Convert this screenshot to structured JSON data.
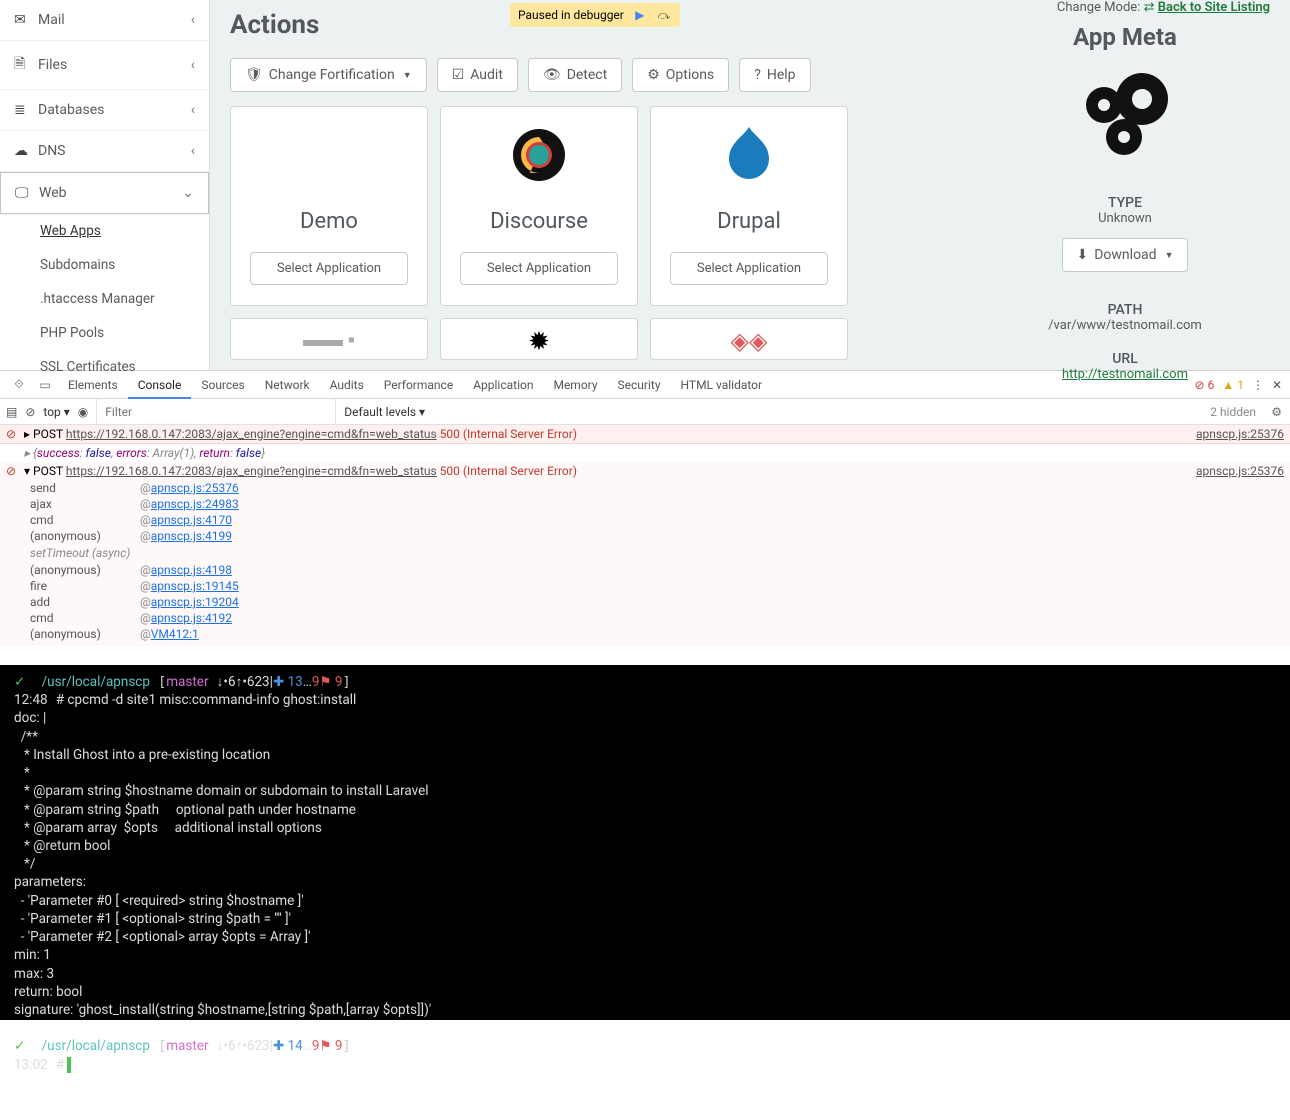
{
  "debug_badge": "Paused in debugger",
  "sidebar": {
    "items": [
      {
        "label": "Mail",
        "icon": "mail"
      },
      {
        "label": "Files",
        "icon": "files"
      },
      {
        "label": "Databases",
        "icon": "db"
      },
      {
        "label": "DNS",
        "icon": "cloud"
      },
      {
        "label": "Web",
        "icon": "web",
        "expanded": true
      }
    ],
    "sub": [
      "Web Apps",
      "Subdomains",
      ".htaccess Manager",
      "PHP Pools",
      "SSL Certificates"
    ]
  },
  "actions": {
    "heading": "Actions",
    "buttons": {
      "fortification": "Change Fortification",
      "audit": "Audit",
      "detect": "Detect",
      "options": "Options",
      "help": "Help"
    },
    "cards": [
      {
        "name": "Demo"
      },
      {
        "name": "Discourse"
      },
      {
        "name": "Drupal"
      }
    ],
    "select_label": "Select Application"
  },
  "meta": {
    "change_mode_label": "Change Mode:",
    "back_link": "Back to Site Listing",
    "heading": "App Meta",
    "type_label": "TYPE",
    "type_value": "Unknown",
    "download": "Download",
    "path_label": "PATH",
    "path_value": "/var/www/testnomail.com",
    "url_label": "URL",
    "url_value": "http://testnomail.com"
  },
  "devtools": {
    "tabs": [
      "Elements",
      "Console",
      "Sources",
      "Network",
      "Audits",
      "Performance",
      "Application",
      "Memory",
      "Security",
      "HTML validator"
    ],
    "active_tab": "Console",
    "err_count": "6",
    "warn_count": "1",
    "toolbar": {
      "context": "top",
      "filter_placeholder": "Filter",
      "levels": "Default levels",
      "hidden": "2 hidden"
    },
    "console": {
      "post_url": "https://192.168.0.147:2083/ajax_engine?engine=cmd&fn=web_status",
      "status": "500 (Internal Server Error)",
      "source": "apnscp.js:25376",
      "obj": "{success: false, errors: Array(1), return: false}",
      "stack": [
        {
          "fn": "send",
          "src": "apnscp.js:25376"
        },
        {
          "fn": "ajax",
          "src": "apnscp.js:24983"
        },
        {
          "fn": "cmd",
          "src": "apnscp.js:4170"
        },
        {
          "fn": "(anonymous)",
          "src": "apnscp.js:4199"
        }
      ],
      "async_label": "setTimeout (async)",
      "stack2": [
        {
          "fn": "(anonymous)",
          "src": "apnscp.js:4198"
        },
        {
          "fn": "fire",
          "src": "apnscp.js:19145"
        },
        {
          "fn": "add",
          "src": "apnscp.js:19204"
        },
        {
          "fn": "cmd",
          "src": "apnscp.js:4192"
        },
        {
          "fn": "(anonymous)",
          "src": "VM412:1"
        }
      ]
    }
  },
  "terminal": {
    "prompt1": {
      "check": "✓",
      "path": "/usr/local/apnscp",
      "branch": "master",
      "stat": "↓•6↑•623|",
      "plus": "✚ 13",
      "dots": "…",
      "flag": "9⚑ 9"
    },
    "time1": "12:48",
    "cmd1": "# cpcmd -d site1 misc:command-info ghost:install",
    "doc_block": "doc: |\n  /**\n   * Install Ghost into a pre-existing location\n   *\n   * @param string $hostname domain or subdomain to install Laravel\n   * @param string $path     optional path under hostname\n   * @param array  $opts     additional install options\n   * @return bool\n   */\nparameters:\n  - 'Parameter #0 [ <required> string $hostname ]'\n  - 'Parameter #1 [ <optional> string $path = '''' ]'\n  - 'Parameter #2 [ <optional> array $opts = Array ]'\nmin: 1\nmax: 3\nreturn: bool\nsignature: 'ghost_install(string $hostname,[string $path,[array $opts]])'",
    "prompt2": {
      "check": "✓",
      "path": "/usr/local/apnscp",
      "branch": "master",
      "stat": "↓•6↑•623|",
      "plus": "✚ 14",
      "dots": "…",
      "flag": "9⚑ 9"
    },
    "time2": "13:02",
    "cmd2": "# "
  }
}
